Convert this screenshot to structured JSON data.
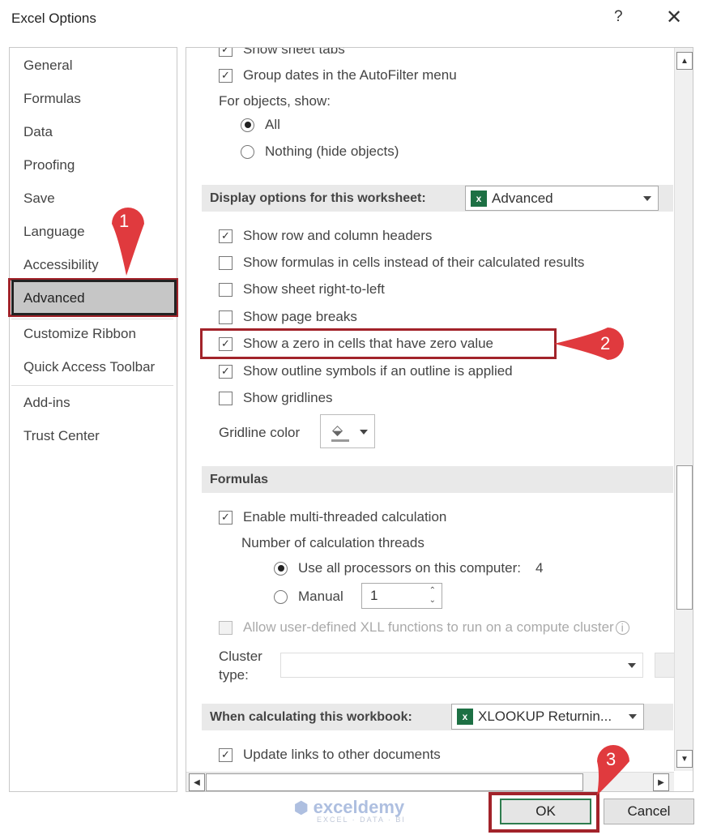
{
  "window": {
    "title": "Excel Options",
    "help": "?",
    "close": "✕"
  },
  "sidebar": {
    "items": [
      {
        "label": "General"
      },
      {
        "label": "Formulas"
      },
      {
        "label": "Data"
      },
      {
        "label": "Proofing"
      },
      {
        "label": "Save"
      },
      {
        "label": "Language"
      },
      {
        "label": "Accessibility"
      },
      {
        "label": "Advanced",
        "selected": true
      },
      {
        "label": "Customize Ribbon"
      },
      {
        "label": "Quick Access Toolbar"
      },
      {
        "label": "Add-ins"
      },
      {
        "label": "Trust Center"
      }
    ]
  },
  "main": {
    "show_sheet_tabs": {
      "label": "Show sheet tabs",
      "checked": true
    },
    "group_dates": {
      "label": "Group dates in the AutoFilter menu",
      "checked": true
    },
    "objects_label": "For objects, show:",
    "objects_all": {
      "label": "All",
      "selected": true
    },
    "objects_nothing": {
      "label": "Nothing (hide objects)",
      "selected": false
    },
    "display_section": {
      "title": "Display options for this worksheet:",
      "sheet": "Advanced"
    },
    "display_options": [
      {
        "label": "Show row and column headers",
        "checked": true
      },
      {
        "label": "Show formulas in cells instead of their calculated results",
        "checked": false
      },
      {
        "label": "Show sheet right-to-left",
        "checked": false
      },
      {
        "label": "Show page breaks",
        "checked": false
      },
      {
        "label": "Show a zero in cells that have zero value",
        "checked": true
      },
      {
        "label": "Show outline symbols if an outline is applied",
        "checked": true
      },
      {
        "label": "Show gridlines",
        "checked": false
      }
    ],
    "gridline_color_label": "Gridline color",
    "formulas_section": {
      "title": "Formulas"
    },
    "multithread": {
      "label": "Enable multi-threaded calculation",
      "checked": true
    },
    "threads_label": "Number of calculation threads",
    "use_all": {
      "label": "Use all processors on this computer:",
      "value": "4",
      "selected": true
    },
    "manual": {
      "label": "Manual",
      "value": "1",
      "selected": false
    },
    "xll": {
      "label": "Allow user-defined XLL functions to run on a compute cluster",
      "checked": false,
      "disabled": true
    },
    "cluster_label_1": "Cluster",
    "cluster_label_2": "type:",
    "workbook_section": {
      "title": "When calculating this workbook:",
      "workbook": "XLOOKUP Returnin..."
    },
    "update_links": {
      "label": "Update links to other documents",
      "checked": true
    }
  },
  "footer": {
    "ok": "OK",
    "cancel": "Cancel"
  },
  "callouts": [
    "1",
    "2",
    "3"
  ],
  "watermark": {
    "brand": "exceldemy",
    "tagline": "EXCEL · DATA · BI"
  },
  "colors": {
    "callout": "#e03a3e",
    "highlight_border": "#a2232a",
    "ok_border": "#2e7d4f"
  }
}
